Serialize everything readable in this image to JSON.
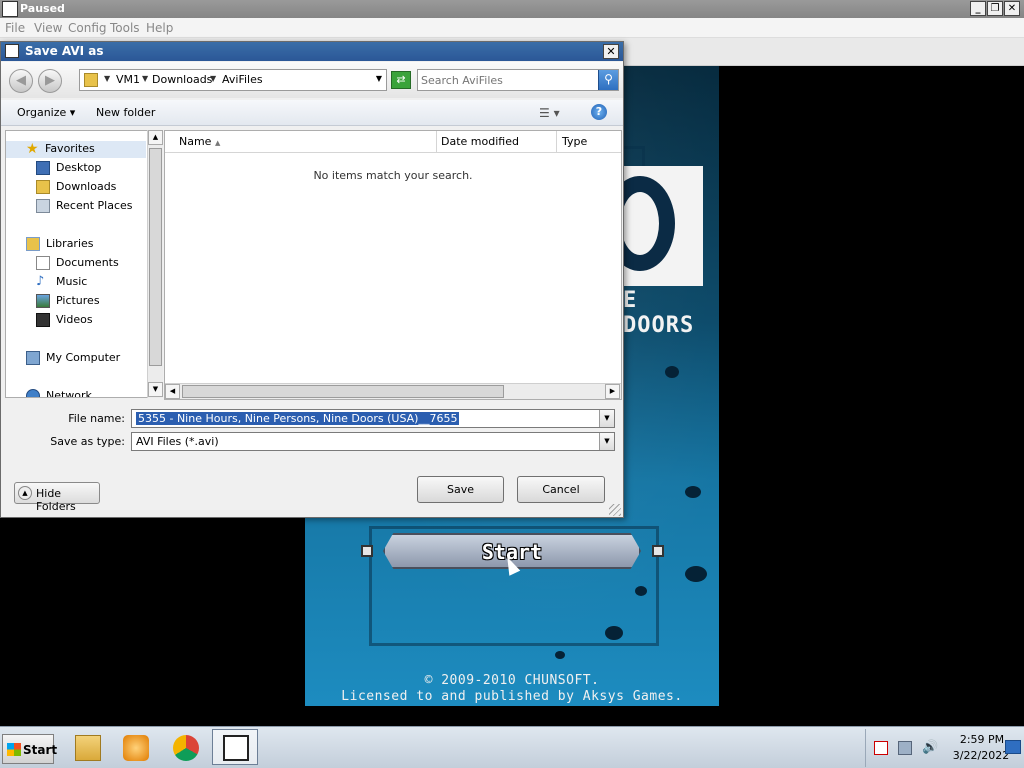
{
  "emulator": {
    "title": "Paused",
    "icon_text": "DeS\nMuME",
    "menu": [
      "File",
      "View",
      "Config",
      "Tools",
      "Help"
    ],
    "controls": {
      "minimize": "_",
      "restore": "❐",
      "close": "✕"
    }
  },
  "game": {
    "logo_text": "E DOORS",
    "start_label": "Start",
    "copyright_line1": "© 2009-2010 CHUNSOFT.",
    "copyright_line2": "Licensed to and published by Aksys Games."
  },
  "dialog": {
    "title": "Save AVI as",
    "close_label": "✕",
    "breadcrumb": [
      "VM1",
      "Downloads",
      "AviFiles"
    ],
    "search_placeholder": "Search AviFiles",
    "toolbar": {
      "organize_label": "Organize",
      "new_folder_label": "New folder",
      "help_label": "?"
    },
    "nav_pane": [
      {
        "label": "Favorites",
        "icon": "star-icon"
      },
      {
        "label": "Desktop",
        "icon": "desktop-icon"
      },
      {
        "label": "Downloads",
        "icon": "downloads-icon"
      },
      {
        "label": "Recent Places",
        "icon": "recent-places-icon"
      },
      {
        "label": "Libraries",
        "icon": "libraries-icon"
      },
      {
        "label": "Documents",
        "icon": "documents-icon"
      },
      {
        "label": "Music",
        "icon": "music-icon"
      },
      {
        "label": "Pictures",
        "icon": "pictures-icon"
      },
      {
        "label": "Videos",
        "icon": "videos-icon"
      },
      {
        "label": "My Computer",
        "icon": "computer-icon"
      },
      {
        "label": "Network",
        "icon": "network-icon"
      }
    ],
    "columns": [
      "Name",
      "Date modified",
      "Type"
    ],
    "empty_message": "No items match your search.",
    "file_name_label": "File name:",
    "file_name_value": "5355 - Nine Hours, Nine Persons, Nine Doors (USA)__7655",
    "save_as_type_label": "Save as type:",
    "save_as_type_value": "AVI Files (*.avi)",
    "hide_folders_label": "Hide Folders",
    "save_label": "Save",
    "cancel_label": "Cancel"
  },
  "taskbar": {
    "start_label": "Start",
    "pinned": [
      "file-explorer-icon",
      "media-player-icon",
      "chrome-icon",
      "desmume-icon"
    ],
    "clock_time": "2:59 PM",
    "clock_date": "3/22/2022"
  },
  "colors": {
    "dialog_title_bar": "#2b5797",
    "selection": "#2b5eb0",
    "game_blue": "#1676a4"
  }
}
